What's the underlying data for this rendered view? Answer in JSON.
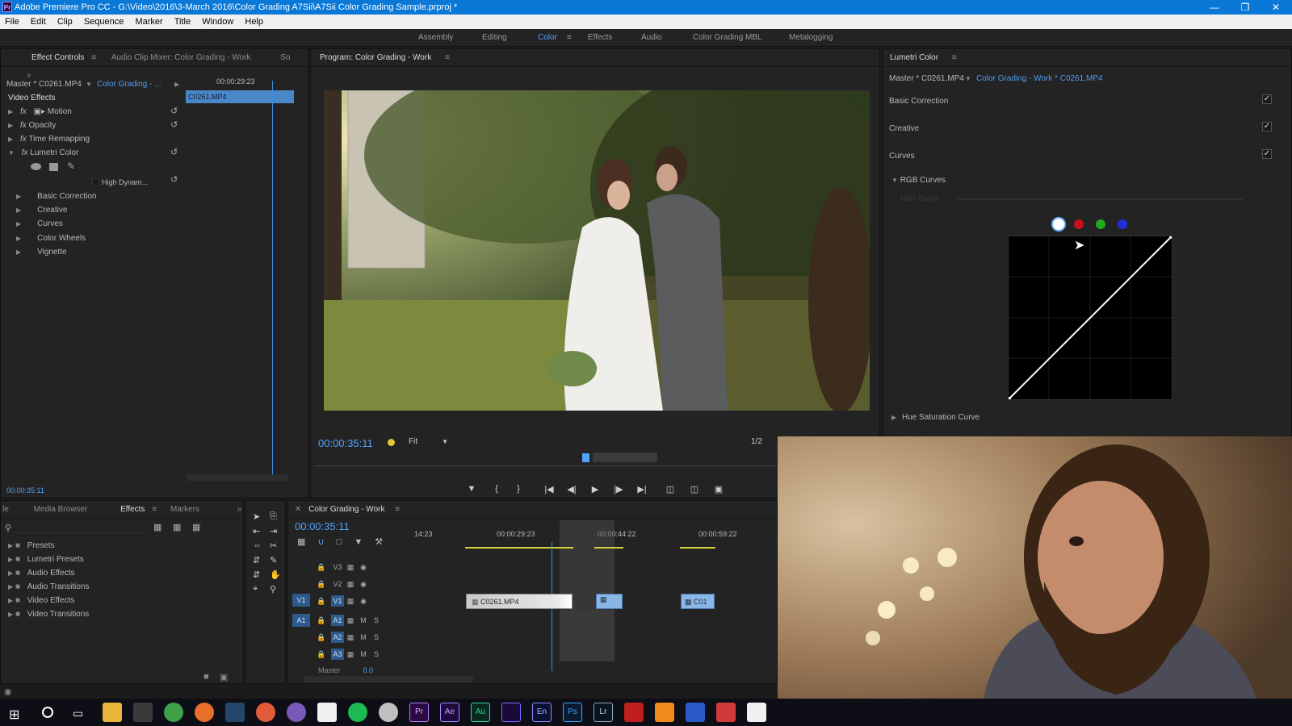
{
  "window": {
    "title": "Adobe Premiere Pro CC - G:\\Video\\2016\\3-March 2016\\Color Grading A7Sii\\A7Sii Color Grading Sample.prproj *",
    "app_icon": "Pr"
  },
  "menu": [
    "File",
    "Edit",
    "Clip",
    "Sequence",
    "Marker",
    "Title",
    "Window",
    "Help"
  ],
  "workspaces": [
    {
      "label": "Assembly"
    },
    {
      "label": "Editing"
    },
    {
      "label": "Color",
      "active": true
    },
    {
      "label": "Effects"
    },
    {
      "label": "Audio"
    },
    {
      "label": "Color Grading MBL"
    },
    {
      "label": "Metalogging"
    }
  ],
  "effect_controls": {
    "tabs": [
      "Effect Controls",
      "Audio Clip Mixer: Color Grading - Work",
      "So"
    ],
    "master": "Master * C0261.MP4",
    "sequence": "Color Grading - ...",
    "timecode_header": "00:00:29:23",
    "clip_label": "C0261.MP4",
    "section": "Video Effects",
    "effects": [
      "Motion",
      "Opacity",
      "Time Remapping",
      "Lumetri Color"
    ],
    "hdr": "High Dynam...",
    "lumetri_sections": [
      "Basic Correction",
      "Creative",
      "Curves",
      "Color Wheels",
      "Vignette"
    ],
    "footer_time": "00:00:35:11"
  },
  "program_monitor": {
    "title": "Program: Color Grading - Work",
    "timecode": "00:00:35:11",
    "fit": "Fit",
    "resolution": "1/2"
  },
  "lumetri": {
    "title": "Lumetri Color",
    "master": "Master * C0261.MP4",
    "sequence": "Color Grading - Work * C0261.MP4",
    "sections": [
      "Basic Correction",
      "Creative",
      "Curves"
    ],
    "rgb_curves": "RGB Curves",
    "hdr_range": "HDR Range",
    "hue_sat": "Hue Saturation Curve",
    "channel_colors": [
      "#ffffff",
      "#c8101c",
      "#1faa1f",
      "#2030d8"
    ]
  },
  "effects_panel": {
    "tabs": [
      "le",
      "Media Browser",
      "Effects",
      "Markers"
    ],
    "items": [
      "Presets",
      "Lumetri Presets",
      "Audio Effects",
      "Audio Transitions",
      "Video Effects",
      "Video Transitions"
    ]
  },
  "timeline": {
    "title": "Color Grading - Work",
    "timecode": "00:00:35:11",
    "ruler": [
      "14:23",
      "00:00:29:23",
      "00:00:44:22",
      "00:00:59:22"
    ],
    "tracks": [
      "V3",
      "V2",
      "V1",
      "A1",
      "A2",
      "A3",
      "Master"
    ],
    "master_value": "0.0",
    "clips": [
      "C0261.MP4",
      "C01"
    ]
  },
  "colors": {
    "accent": "#4f9cf0",
    "titlebar": "#0a78d7",
    "timecode": "#4fa3ff"
  }
}
